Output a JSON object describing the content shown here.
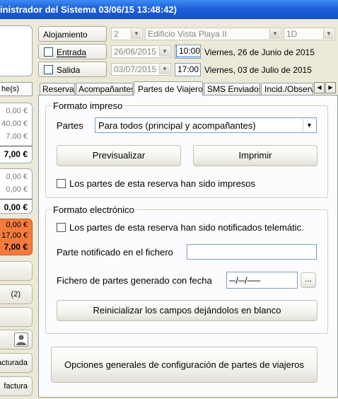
{
  "window": {
    "title": "inistrador del Sistema 03/06/15 13:48:42)"
  },
  "sidebar": {
    "tab_fragment": "he(s)",
    "panel1": {
      "rows": [
        "0,00 €",
        "40,00 €",
        "7,00 €"
      ],
      "total": "7,00 €"
    },
    "panel2": {
      "rows": [
        "0,00 €",
        "0,00 €"
      ],
      "total": "0,00 €"
    },
    "panel3": {
      "rows": [
        "0,00 €",
        "17,00 €"
      ],
      "total": "7,00 €"
    },
    "count_button": "(2)",
    "button_facturada": "acturada",
    "button_factura": "factura"
  },
  "header": {
    "alojamiento_label": "Alojamiento",
    "alojamiento_num": "2",
    "edificio": "Edificio Vista Playa II",
    "unidad": "1D",
    "entrada_label": "Entrada",
    "entrada_fecha": "26/06/2015",
    "entrada_hora": "10:00",
    "entrada_texto": "Viernes, 26 de Junio de 2015",
    "salida_label": "Salida",
    "salida_fecha": "03/07/2015",
    "salida_hora": "17:00",
    "salida_texto": "Viernes, 03 de Julio de 2015"
  },
  "tabs": [
    {
      "label": "Reserva"
    },
    {
      "label": "Acompañantes"
    },
    {
      "label": "Partes de Viajeros"
    },
    {
      "label": "SMS Enviados"
    },
    {
      "label": "Incid./Observ."
    }
  ],
  "formato_impreso": {
    "legend": "Formato impreso",
    "partes_label": "Partes",
    "partes_value": "Para todos (principal y acompañantes)",
    "previsualizar": "Previsualizar",
    "imprimir": "Imprimir",
    "impresos_check": "Los partes de esta reserva han sido impresos"
  },
  "formato_electronico": {
    "legend": "Formato electrónico",
    "notificados_check": "Los partes de esta reserva han sido notificados telemátic.",
    "fichero_label": "Parte notificado en el fichero",
    "fichero_value": "",
    "fecha_label": "Fichero de partes generado con fecha",
    "fecha_value": "─/─/──",
    "browse": "...",
    "reinicializar": "Reinicializar los campos dejándolos en blanco"
  },
  "opciones_button": "Opciones generales de configuración de partes de viajeros"
}
